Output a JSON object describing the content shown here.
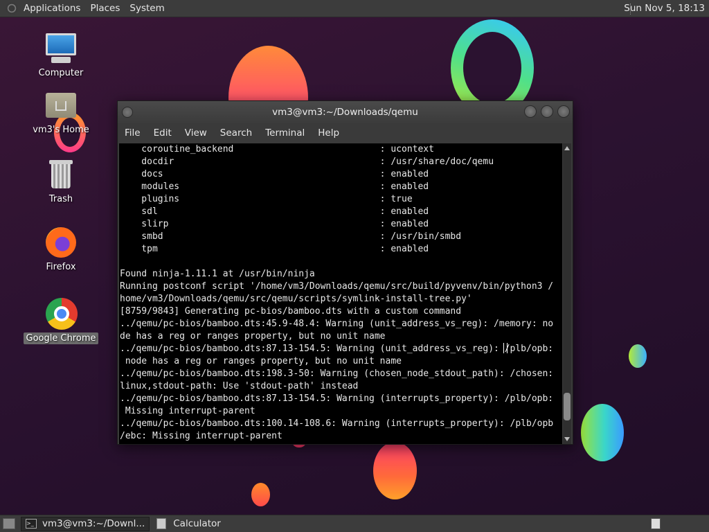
{
  "top_panel": {
    "menus": [
      "Applications",
      "Places",
      "System"
    ],
    "clock": "Sun Nov  5, 18:13"
  },
  "desktop_icons": {
    "computer": "Computer",
    "home": "vm3's Home",
    "trash": "Trash",
    "firefox": "Firefox",
    "chrome": "Google Chrome"
  },
  "window": {
    "title": "vm3@vm3:~/Downloads/qemu",
    "menu": [
      "File",
      "Edit",
      "View",
      "Search",
      "Terminal",
      "Help"
    ]
  },
  "terminal": {
    "lines": [
      "    coroutine_backend                           : ucontext",
      "    docdir                                      : /usr/share/doc/qemu",
      "    docs                                        : enabled",
      "    modules                                     : enabled",
      "    plugins                                     : true",
      "    sdl                                         : enabled",
      "    slirp                                       : enabled",
      "    smbd                                        : /usr/bin/smbd",
      "    tpm                                         : enabled",
      "",
      "Found ninja-1.11.1 at /usr/bin/ninja",
      "Running postconf script '/home/vm3/Downloads/qemu/src/build/pyvenv/bin/python3 /",
      "home/vm3/Downloads/qemu/src/qemu/scripts/symlink-install-tree.py'",
      "[8759/9843] Generating pc-bios/bamboo.dts with a custom command",
      "../qemu/pc-bios/bamboo.dts:45.9-48.4: Warning (unit_address_vs_reg): /memory: no",
      "de has a reg or ranges property, but no unit name",
      "../qemu/pc-bios/bamboo.dts:87.13-154.5: Warning (unit_address_vs_reg): /plb/opb:",
      " node has a reg or ranges property, but no unit name",
      "../qemu/pc-bios/bamboo.dts:198.3-50: Warning (chosen_node_stdout_path): /chosen:",
      "linux,stdout-path: Use 'stdout-path' instead",
      "../qemu/pc-bios/bamboo.dts:87.13-154.5: Warning (interrupts_property): /plb/opb:",
      " Missing interrupt-parent",
      "../qemu/pc-bios/bamboo.dts:100.14-108.6: Warning (interrupts_property): /plb/opb",
      "/ebc: Missing interrupt-parent"
    ]
  },
  "taskbar": {
    "tasks": [
      "vm3@vm3:~/Downl...",
      "Calculator"
    ]
  }
}
